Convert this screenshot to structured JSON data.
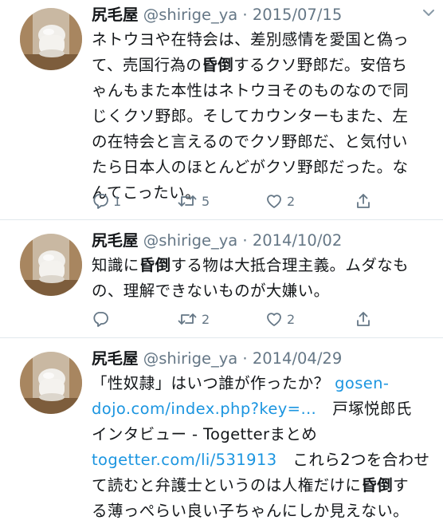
{
  "tweets": [
    {
      "name": "尻毛屋",
      "handle": "@shirige_ya",
      "sep": "·",
      "date": "2015/07/15",
      "lines": [
        [
          {
            "t": "ネトウヨや在特会は、差別感情を愛国と偽っ"
          }
        ],
        [
          {
            "t": "て、売国行為の"
          },
          {
            "t": "昏倒",
            "b": true
          },
          {
            "t": "するクソ野郎だ。安倍ち"
          }
        ],
        [
          {
            "t": "ゃんもまた本性はネトウヨそのものなので同"
          }
        ],
        [
          {
            "t": "じくクソ野郎。そしてカウンターもまた、左"
          }
        ],
        [
          {
            "t": "の在特会と言えるのでクソ野郎だ、と気付い"
          }
        ],
        [
          {
            "t": "たら日本人のほとんどがクソ野郎だった。な"
          }
        ],
        [
          {
            "t": "んてこったい。"
          }
        ]
      ],
      "replies": "1",
      "retweets": "5",
      "likes": "2"
    },
    {
      "name": "尻毛屋",
      "handle": "@shirige_ya",
      "sep": "·",
      "date": "2014/10/02",
      "lines": [
        [
          {
            "t": "知識に"
          },
          {
            "t": "昏倒",
            "b": true
          },
          {
            "t": "する物は大抵合理主義。ムダなも"
          }
        ],
        [
          {
            "t": "の、理解できないものが大嫌い。"
          }
        ]
      ],
      "replies": "",
      "retweets": "2",
      "likes": "2"
    },
    {
      "name": "尻毛屋",
      "handle": "@shirige_ya",
      "sep": "·",
      "date": "2014/04/29",
      "lines": [
        [
          {
            "t": "「性奴隷」はいつ誰が作ったか？ "
          },
          {
            "t": "gosen-",
            "link": true
          }
        ],
        [
          {
            "t": "dojo.com/index.php?key=…",
            "link": true
          },
          {
            "t": "　戸塚悦郎氏"
          }
        ],
        [
          {
            "t": "インタビュー - Togetterまとめ"
          }
        ],
        [
          {
            "t": "togetter.com/li/531913",
            "link": true
          },
          {
            "t": "　これら2つを合わせ"
          }
        ],
        [
          {
            "t": "て読むと弁護士というのは人権だけに"
          },
          {
            "t": "昏倒",
            "b": true
          },
          {
            "t": "す"
          }
        ],
        [
          {
            "t": "る薄っぺらい良い子ちゃんにしか見えない。"
          }
        ]
      ]
    }
  ],
  "icons": {
    "caret": "chevron-down-icon",
    "reply": "reply-icon",
    "retweet": "retweet-icon",
    "like": "heart-icon",
    "share": "share-icon"
  },
  "colors": {
    "link": "#1b95e0",
    "secondary_text": "#657786",
    "divider": "#e1e8ed"
  }
}
